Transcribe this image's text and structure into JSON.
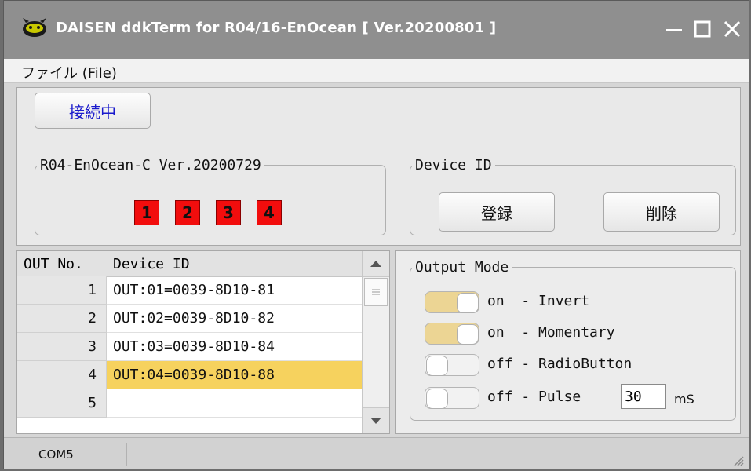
{
  "window": {
    "title": "DAISEN ddkTerm for R04/16-EnOcean [ Ver.20200801 ]",
    "controls": {
      "minimize_icon": "minimize-icon",
      "maximize_icon": "maximize-icon",
      "close_icon": "close-icon"
    }
  },
  "menu": {
    "file_label": "ファイル (File)"
  },
  "connection": {
    "button_label": "接続中"
  },
  "version_group": {
    "legend": "R04-EnOcean-C Ver.20200729",
    "leds": [
      "1",
      "2",
      "3",
      "4"
    ],
    "led_color": "#f20d0d"
  },
  "device_group": {
    "legend": "Device ID",
    "register_label": "登録",
    "delete_label": "削除"
  },
  "grid": {
    "headers": {
      "out_no": "OUT No.",
      "device_id": "Device ID"
    },
    "rows": [
      {
        "no": "1",
        "device": "OUT:01=0039-8D10-81"
      },
      {
        "no": "2",
        "device": "OUT:02=0039-8D10-82"
      },
      {
        "no": "3",
        "device": "OUT:03=0039-8D10-84"
      },
      {
        "no": "4",
        "device": "OUT:04=0039-8D10-88"
      },
      {
        "no": "5",
        "device": ""
      }
    ],
    "selected_row": 4,
    "selected_color": "#f6d25e"
  },
  "output_mode": {
    "legend": "Output Mode",
    "options": [
      {
        "state": "on",
        "label": "on  - Invert"
      },
      {
        "state": "on",
        "label": "on  - Momentary"
      },
      {
        "state": "off",
        "label": "off - RadioButton"
      },
      {
        "state": "off",
        "label": "off - Pulse"
      }
    ],
    "pulse_value": "30",
    "pulse_unit": "mS",
    "toggle_on_color": "#ecd594"
  },
  "status": {
    "port": "COM5"
  }
}
